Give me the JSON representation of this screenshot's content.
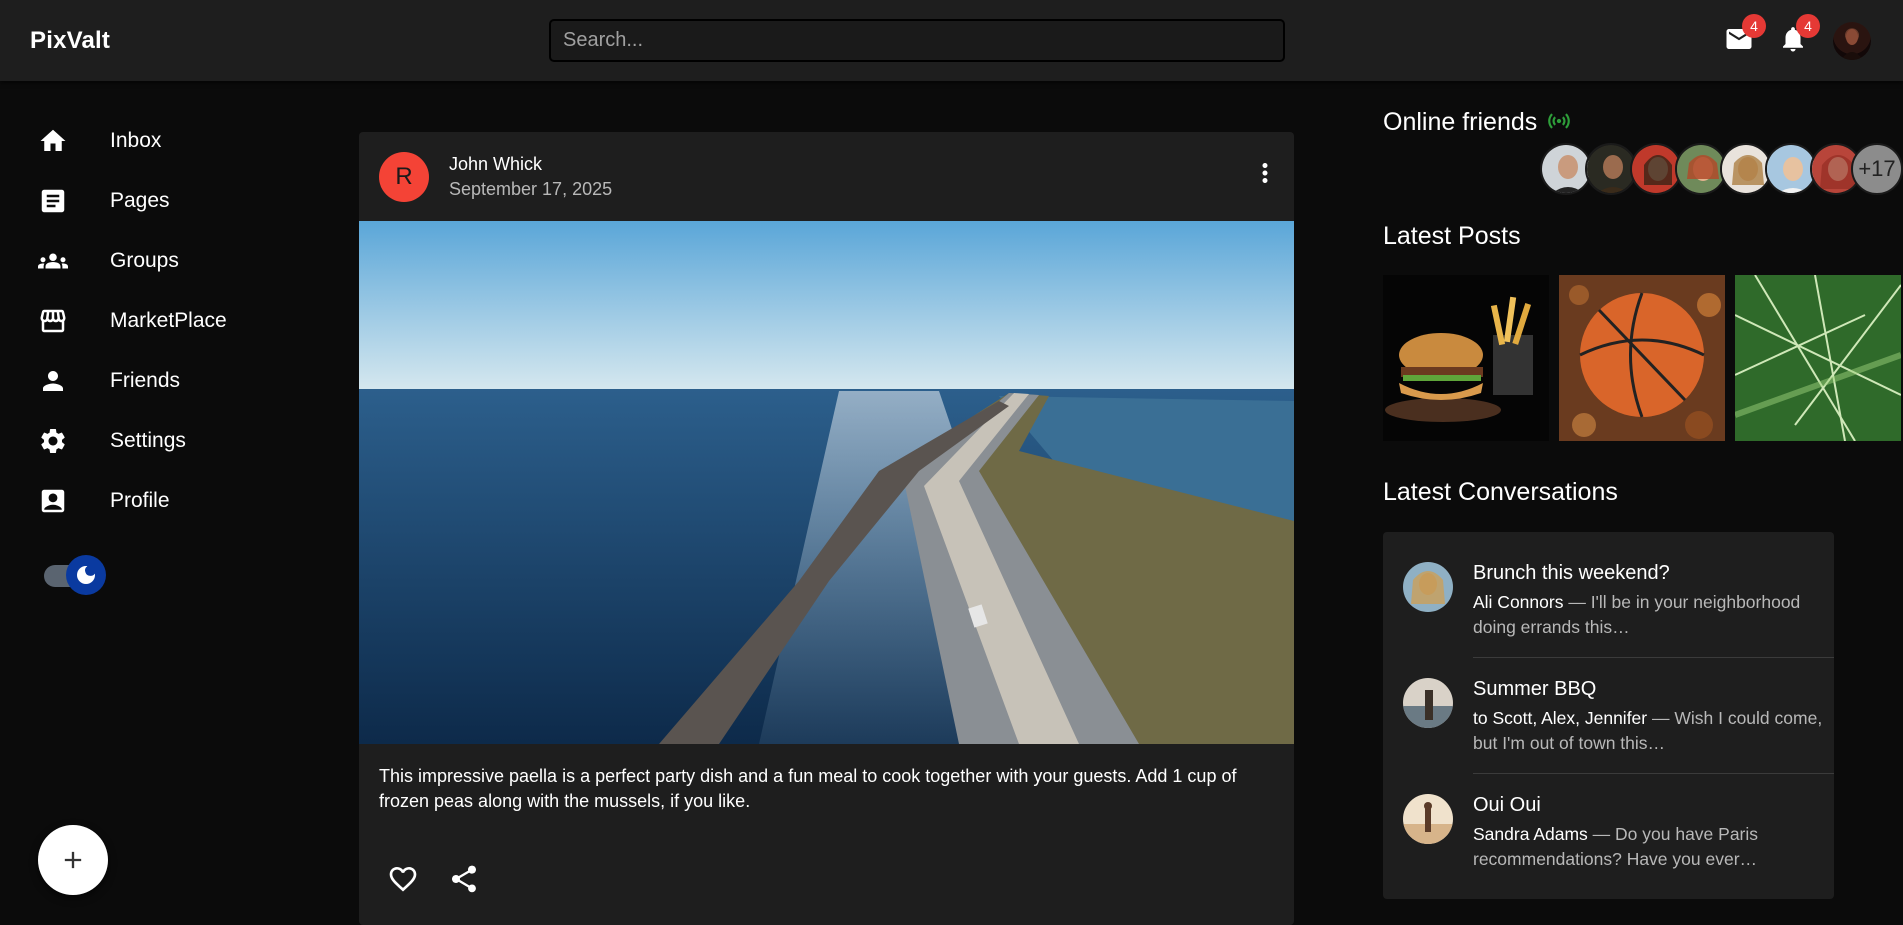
{
  "app": {
    "brand": "PixValt",
    "search_placeholder": "Search...",
    "mail_badge": "4",
    "notif_badge": "4"
  },
  "sidebar": {
    "items": [
      {
        "label": "Inbox",
        "icon": "home-icon"
      },
      {
        "label": "Pages",
        "icon": "article-icon"
      },
      {
        "label": "Groups",
        "icon": "groups-icon"
      },
      {
        "label": "MarketPlace",
        "icon": "storefront-icon"
      },
      {
        "label": "Friends",
        "icon": "person-icon"
      },
      {
        "label": "Settings",
        "icon": "gear-icon"
      },
      {
        "label": "Profile",
        "icon": "profile-card-icon"
      }
    ],
    "dark_mode": true
  },
  "post": {
    "avatar_letter": "R",
    "author": "John Whick",
    "date": "September 17, 2025",
    "text": "This impressive paella is a perfect party dish and a fun meal to cook together with your guests. Add 1 cup of frozen peas along with the mussels, if you like."
  },
  "right": {
    "online_title": "Online friends",
    "online_more": "+17",
    "latest_posts_title": "Latest Posts",
    "latest_conversations_title": "Latest Conversations",
    "conversations": [
      {
        "title": "Brunch this weekend?",
        "from": "Ali Connors",
        "snippet": " — I'll be in your neighborhood doing errands this…"
      },
      {
        "title": "Summer BBQ",
        "from": "to Scott, Alex, Jennifer",
        "snippet": " — Wish I could come, but I'm out of town this…"
      },
      {
        "title": "Oui Oui",
        "from": "Sandra Adams",
        "snippet": " — Do you have Paris recommendations? Have you ever…"
      }
    ]
  },
  "colors": {
    "accent_red": "#f44336",
    "badge_red": "#e53935",
    "online_green": "#2e9e3a",
    "toggle_blue": "#0a3aa0"
  }
}
